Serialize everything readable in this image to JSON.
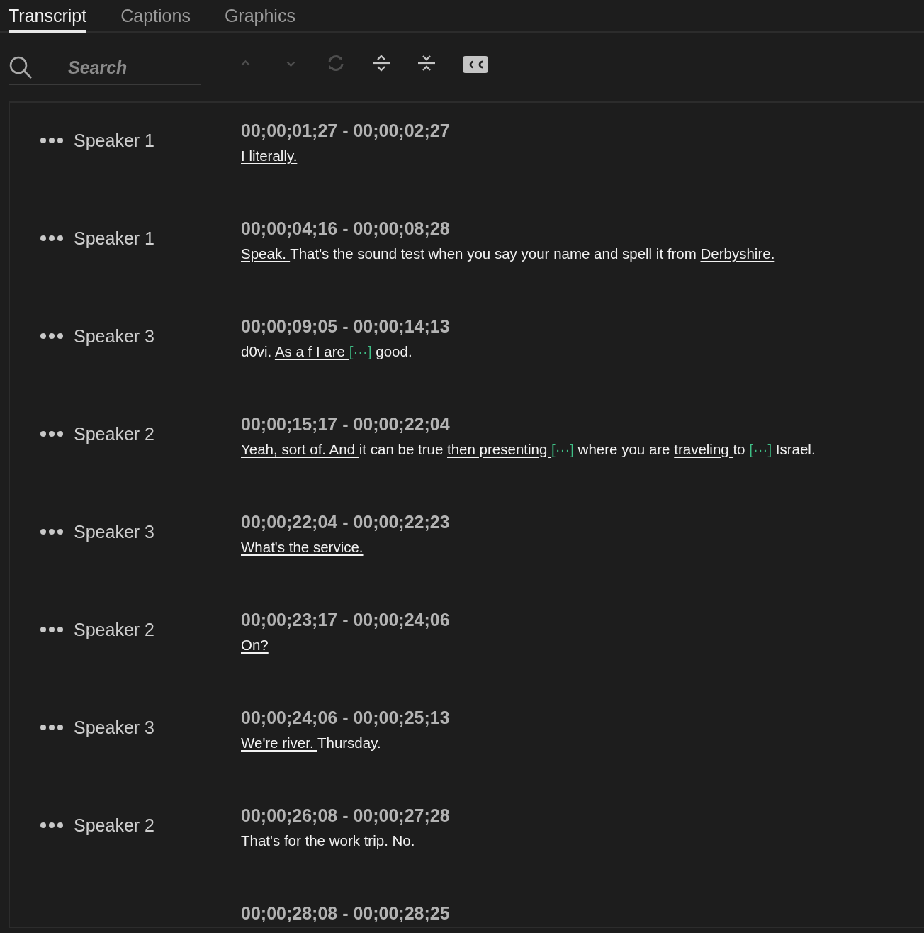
{
  "tabs": [
    {
      "label": "Transcript",
      "selected": true
    },
    {
      "label": "Captions",
      "selected": false
    },
    {
      "label": "Graphics",
      "selected": false
    }
  ],
  "search": {
    "placeholder": "Search"
  },
  "toolbar": [
    {
      "kind": "up",
      "disabled": true
    },
    {
      "kind": "down",
      "disabled": true
    },
    {
      "kind": "sync",
      "disabled": true
    },
    {
      "kind": "expand",
      "disabled": false
    },
    {
      "kind": "collapse",
      "disabled": false
    },
    {
      "kind": "cc",
      "disabled": false
    }
  ],
  "segments": [
    {
      "speaker": "Speaker 1",
      "time": "00;00;01;27 - 00;00;02;27",
      "spans": [
        {
          "kind": "word",
          "text": "I literally.",
          "underlined": true
        }
      ]
    },
    {
      "speaker": "Speaker 1",
      "time": "00;00;04;16 - 00;00;08;28",
      "spans": [
        {
          "kind": "word",
          "text": "Speak. ",
          "underlined": true
        },
        {
          "kind": "word",
          "text": "That's the sound test when you say your name and spell it from ",
          "underlined": false
        },
        {
          "kind": "word",
          "text": "Derbyshire.",
          "underlined": true
        }
      ]
    },
    {
      "speaker": "Speaker 3",
      "time": "00;00;09;05 - 00;00;14;13",
      "spans": [
        {
          "kind": "word",
          "text": "d0vi. ",
          "underlined": false
        },
        {
          "kind": "word",
          "text": "As a f I are ",
          "underlined": true
        },
        {
          "kind": "gap",
          "text": "[···]"
        },
        {
          "kind": "word",
          "text": " good.",
          "underlined": false
        }
      ]
    },
    {
      "speaker": "Speaker 2",
      "time": "00;00;15;17 - 00;00;22;04",
      "spans": [
        {
          "kind": "word",
          "text": "Yeah, sort of. And ",
          "underlined": true
        },
        {
          "kind": "word",
          "text": "it can be true ",
          "underlined": false
        },
        {
          "kind": "word",
          "text": "then presenting ",
          "underlined": true
        },
        {
          "kind": "gap",
          "text": "[···]"
        },
        {
          "kind": "word",
          "text": " where you are ",
          "underlined": false
        },
        {
          "kind": "word",
          "text": "traveling ",
          "underlined": true
        },
        {
          "kind": "word",
          "text": "to ",
          "underlined": false
        },
        {
          "kind": "gap",
          "text": "[···]"
        },
        {
          "kind": "word",
          "text": " Israel.",
          "underlined": false
        }
      ]
    },
    {
      "speaker": "Speaker 3",
      "time": "00;00;22;04 - 00;00;22;23",
      "spans": [
        {
          "kind": "word",
          "text": "What's the service.",
          "underlined": true
        }
      ]
    },
    {
      "speaker": "Speaker 2",
      "time": "00;00;23;17 - 00;00;24;06",
      "spans": [
        {
          "kind": "word",
          "text": "On?",
          "underlined": true
        }
      ]
    },
    {
      "speaker": "Speaker 3",
      "time": "00;00;24;06 - 00;00;25;13",
      "spans": [
        {
          "kind": "word",
          "text": "We're river. ",
          "underlined": true
        },
        {
          "kind": "word",
          "text": "Thursday.",
          "underlined": false
        }
      ]
    },
    {
      "speaker": "Speaker 2",
      "time": "00;00;26;08 - 00;00;27;28",
      "spans": [
        {
          "kind": "word",
          "text": "That's for the work trip. No.",
          "underlined": false
        }
      ]
    },
    {
      "time": "00;00;28;08 - 00;00;28;25"
    }
  ]
}
